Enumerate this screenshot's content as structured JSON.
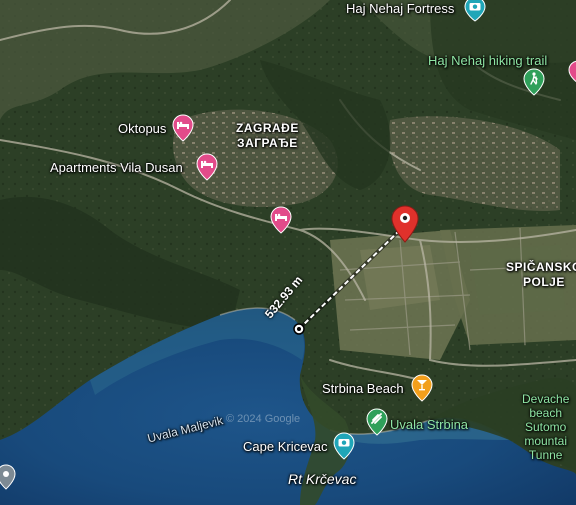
{
  "map": {
    "colors": {
      "forest_dark": "#22331e",
      "forest": "#344a2c",
      "scrub": "#5e6a4c",
      "field": "#6e7553",
      "sea_shallow": "#2c6a8c",
      "sea": "#1a4a7a",
      "sea_deep": "#123a68",
      "poi_pink": "#e24b8a",
      "poi_teal": "#20a6b8",
      "poi_green": "#2fa05a",
      "poi_orange": "#f29f1c",
      "pin_red": "#e0312b"
    },
    "labels": {
      "haj_nehaj_fortress": "Haj Nehaj Fortress",
      "haj_nehaj_trail": "Haj Nehaj hiking trail",
      "oktopus": "Oktopus",
      "apartments_vila_dusan": "Apartments Vila Dusan",
      "zagradje_latin": "ZAGRAĐE",
      "zagradje_cyrillic": "ЗАГРАЂЕ",
      "spicansko_line1": "SPIČANSKO",
      "spicansko_line2": "POLJE",
      "strbina_beach": "Strbina Beach",
      "uvala_strbina": "Uvala Strbina",
      "uvala_maljevik": "Uvala Maljevik",
      "cape_kricevac": "Cape Kricevac",
      "rt_krcevac": "Rt Krčevac",
      "devache_line1": "Devache",
      "devache_line2": "beach",
      "devache_line3": "Sutomo",
      "devache_line4": "mountai",
      "devache_line5": "Tunne",
      "watermark": "© 2024 Google"
    },
    "measurement": {
      "distance_label": "532.93 m"
    },
    "icons": {
      "hotel": "hotel-icon",
      "camera": "camera-icon",
      "hiker": "hiker-icon",
      "cocktail": "cocktail-icon",
      "park": "park-icon",
      "location_pin": "location-pin-icon"
    }
  }
}
